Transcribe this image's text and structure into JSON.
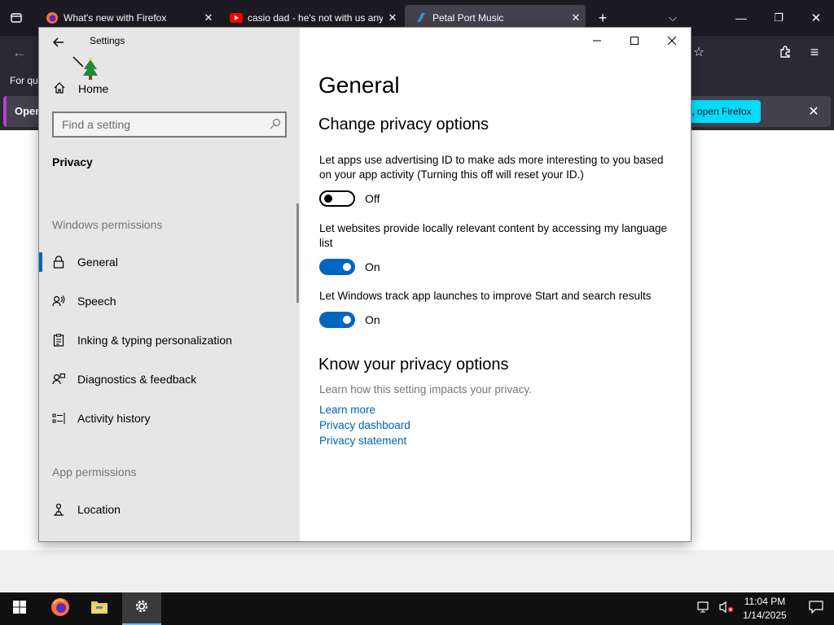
{
  "firefox": {
    "tabs": [
      {
        "label": "What's new with Firefox"
      },
      {
        "label": "casio dad - he's not with us any"
      },
      {
        "label": "Petal Port Music"
      }
    ],
    "bookmarks_text": "For qu",
    "notification_text": "Open",
    "notification_button": ", open Firefox"
  },
  "settings": {
    "app_title": "Settings",
    "home_label": "Home",
    "search_placeholder": "Find a setting",
    "section_title": "Privacy",
    "nav_groups": {
      "windows_permissions": "Windows permissions",
      "app_permissions": "App permissions"
    },
    "nav_items": [
      {
        "label": "General",
        "icon": "lock-icon",
        "selected": true
      },
      {
        "label": "Speech",
        "icon": "speech-icon"
      },
      {
        "label": "Inking & typing personalization",
        "icon": "inking-icon"
      },
      {
        "label": "Diagnostics & feedback",
        "icon": "diagnostics-icon"
      },
      {
        "label": "Activity history",
        "icon": "activity-icon"
      },
      {
        "label": "Location",
        "icon": "location-icon"
      }
    ],
    "page_title": "General",
    "change_heading": "Change privacy options",
    "options": [
      {
        "description": "Let apps use advertising ID to make ads more interesting to you based on your app activity (Turning this off will reset your ID.)",
        "state": "Off"
      },
      {
        "description": "Let websites provide locally relevant content by accessing my language list",
        "state": "On"
      },
      {
        "description": "Let Windows track app launches to improve Start and search results",
        "state": "On"
      }
    ],
    "know_heading": "Know your privacy options",
    "know_description": "Learn how this setting impacts your privacy.",
    "links": [
      "Learn more",
      "Privacy dashboard",
      "Privacy statement"
    ]
  },
  "taskbar": {
    "time": "11:04 PM",
    "date": "1/14/2025"
  },
  "colors": {
    "accent": "#0067c0",
    "link": "#0063b1",
    "firefox_dark": "#1c1b22",
    "taskbar": "#101010"
  }
}
